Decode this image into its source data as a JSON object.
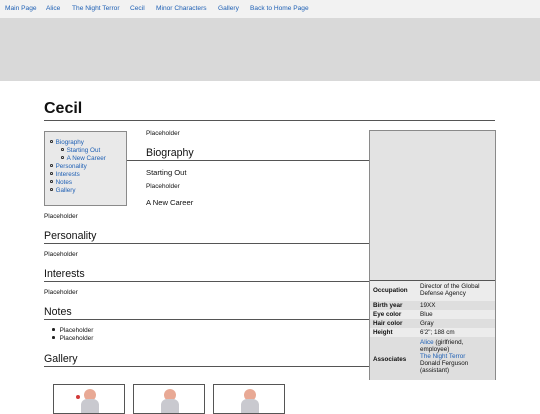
{
  "nav": {
    "items": [
      "Main Page",
      "Alice",
      "The Night Terror",
      "Cecil",
      "Minor Characters",
      "Gallery",
      "Back to Home Page"
    ]
  },
  "page": {
    "title": "Cecil"
  },
  "toc": {
    "items": [
      "Biography",
      "Starting Out",
      "A New Career",
      "Personality",
      "Interests",
      "Notes",
      "Gallery"
    ]
  },
  "content": {
    "intro": "Placeholder",
    "biography_heading": "Biography",
    "starting_out_heading": "Starting Out",
    "starting_out_text": "Placeholder",
    "new_career_heading": "A New Career",
    "new_career_text": "Placeholder",
    "personality_heading": "Personality",
    "personality_text": "Placeholder",
    "interests_heading": "Interests",
    "interests_text": "Placeholder",
    "notes_heading": "Notes",
    "notes_items": [
      "Placeholder",
      "Placeholder"
    ],
    "gallery_heading": "Gallery"
  },
  "infobox": {
    "occupation_label": "Occupation",
    "occupation_value": "Director of the Global Defense Agency",
    "birth_year_label": "Birth year",
    "birth_year_value": "19XX",
    "eye_color_label": "Eye color",
    "eye_color_value": "Blue",
    "hair_color_label": "Hair color",
    "hair_color_value": "Gray",
    "height_label": "Height",
    "height_value": "6'2\"; 188 cm",
    "associates_label": "Associates",
    "associates": {
      "alice_link": "Alice",
      "alice_note": "(girlfriend, employee)",
      "night_terror_link": "The Night Terror",
      "donald": "Donald Ferguson",
      "donald_note": "(assistant)"
    }
  },
  "colors": {
    "link": "#1d5fb4",
    "banner": "#d9d9d9",
    "infobox_bg": "#ececec"
  }
}
